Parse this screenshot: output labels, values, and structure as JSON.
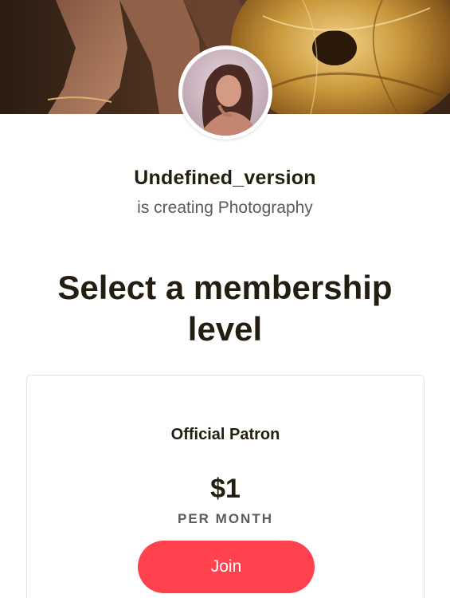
{
  "creator": {
    "name": "Undefined_version",
    "subtitle": "is creating Photography"
  },
  "page": {
    "heading": "Select a membership level"
  },
  "tier": {
    "name": "Official Patron",
    "price": "$1",
    "period": "PER MONTH",
    "join_label": "Join"
  },
  "colors": {
    "accent": "#ff424d",
    "text_primary": "#241e12",
    "text_secondary": "#5c5b57"
  }
}
